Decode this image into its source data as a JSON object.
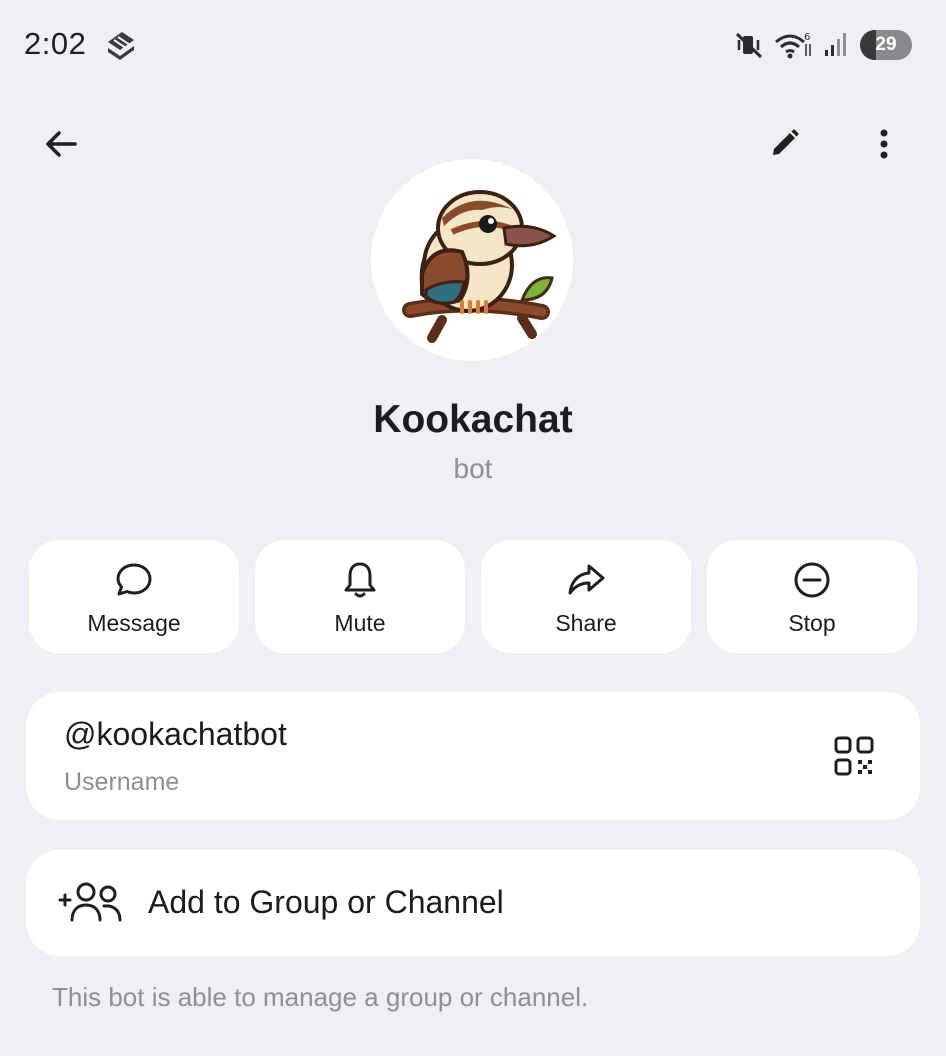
{
  "status_bar": {
    "time": "2:02",
    "battery_level": "29"
  },
  "toolbar": {
    "back_icon": "arrow-left-icon",
    "edit_icon": "pencil-icon",
    "more_icon": "more-vertical-icon"
  },
  "profile": {
    "name": "Kookachat",
    "subtitle": "bot",
    "avatar": "kookaburra-avatar"
  },
  "actions": [
    {
      "label": "Message",
      "icon": "message-bubble-icon"
    },
    {
      "label": "Mute",
      "icon": "bell-icon"
    },
    {
      "label": "Share",
      "icon": "share-arrow-icon"
    },
    {
      "label": "Stop",
      "icon": "stop-circle-icon"
    }
  ],
  "username_card": {
    "value": "@kookachatbot",
    "label": "Username",
    "icon": "qr-code-icon"
  },
  "add_group": {
    "label": "Add to Group or Channel",
    "icon": "add-users-icon"
  },
  "footnote": "This bot is able to manage a group or channel.",
  "colors": {
    "background": "#efeff4",
    "card": "#ffffff",
    "text_primary": "#1c1c1e",
    "text_secondary": "#8e8e93"
  }
}
